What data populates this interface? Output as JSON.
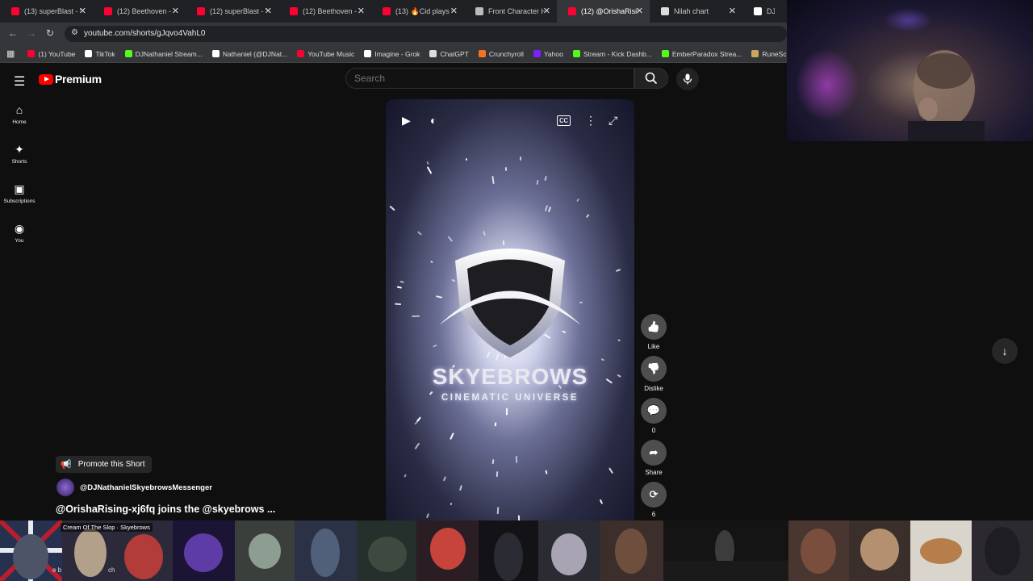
{
  "browser": {
    "tabs": [
      {
        "title": "(13) superBlast - W",
        "favicon": "youtube",
        "color": "#ff0033"
      },
      {
        "title": "(12) Beethoven - Fi",
        "favicon": "youtube",
        "color": "#ff0033"
      },
      {
        "title": "(12) superBlast - W",
        "favicon": "youtube",
        "color": "#ff0033"
      },
      {
        "title": "(12) Beethoven - M",
        "favicon": "youtube",
        "color": "#ff0033"
      },
      {
        "title": "(13) 🔥Cid plays th",
        "favicon": "youtube",
        "color": "#ff0033"
      },
      {
        "title": "Front Character He",
        "favicon": "globe",
        "color": "#bbbbbb"
      },
      {
        "title": "(12) @OrishaRising",
        "favicon": "youtube",
        "color": "#ff0033",
        "active": true
      },
      {
        "title": "Nilah chart",
        "favicon": "chatgpt",
        "color": "#dddddd"
      },
      {
        "title": "DJ Na",
        "favicon": "tiktok",
        "color": "#ffffff"
      }
    ],
    "close_glyph": "✕",
    "url": "youtube.com/shorts/gJqvo4VahL0",
    "bookmarks": [
      {
        "label": "(1) YouTube",
        "color": "#ff0033"
      },
      {
        "label": "TikTok",
        "color": "#ffffff"
      },
      {
        "label": "DJNathaniel Stream...",
        "color": "#53fc18"
      },
      {
        "label": "Nathaniel (@DJNat...",
        "color": "#ffffff"
      },
      {
        "label": "YouTube Music",
        "color": "#ff0033"
      },
      {
        "label": "Imagine - Grok",
        "color": "#ffffff"
      },
      {
        "label": "ChatGPT",
        "color": "#dddddd"
      },
      {
        "label": "Crunchyroll",
        "color": "#f47521"
      },
      {
        "label": "Yahoo",
        "color": "#7e1fff"
      },
      {
        "label": "Stream - Kick Dashb...",
        "color": "#53fc18"
      },
      {
        "label": "EmberParadox Strea...",
        "color": "#53fc18"
      },
      {
        "label": "RuneScape Online",
        "color": "#c9a75a"
      }
    ]
  },
  "youtube": {
    "brand": "Premium",
    "search_placeholder": "Search",
    "sidebar": [
      {
        "label": "Home",
        "icon": "home-icon",
        "glyph": "⌂"
      },
      {
        "label": "Shorts",
        "icon": "shorts-icon",
        "glyph": "✦"
      },
      {
        "label": "Subscriptions",
        "icon": "subscriptions-icon",
        "glyph": "▣"
      },
      {
        "label": "You",
        "icon": "user-icon",
        "glyph": "◉"
      }
    ],
    "video_overlay": {
      "brand_line1": "SKYEBROWS",
      "brand_line2": "CINEMATIC UNIVERSE"
    },
    "actions": [
      {
        "label": "Like",
        "icon": "like-icon",
        "glyph": "👍"
      },
      {
        "label": "Dislike",
        "icon": "dislike-icon",
        "glyph": "👎"
      },
      {
        "label": "0",
        "icon": "comments-icon",
        "glyph": "💬"
      },
      {
        "label": "Share",
        "icon": "share-icon",
        "glyph": "➦"
      },
      {
        "label": "6",
        "icon": "remix-icon",
        "glyph": "⟳"
      }
    ],
    "promote_label": "Promote this Short",
    "channel": "@DJNathanielSkyebrowsMessenger",
    "title": "@OrishaRising-xj6fq  joins the @skyebrows ...",
    "music": "Cream Of The Slop · Skyebrows",
    "music_fragment_a": "e b",
    "music_fragment_b": "ch"
  },
  "colors": {
    "background": "#0f0f0f",
    "tabstrip": "#202124",
    "toolbar": "#35363a",
    "accent_red": "#ff0000"
  }
}
